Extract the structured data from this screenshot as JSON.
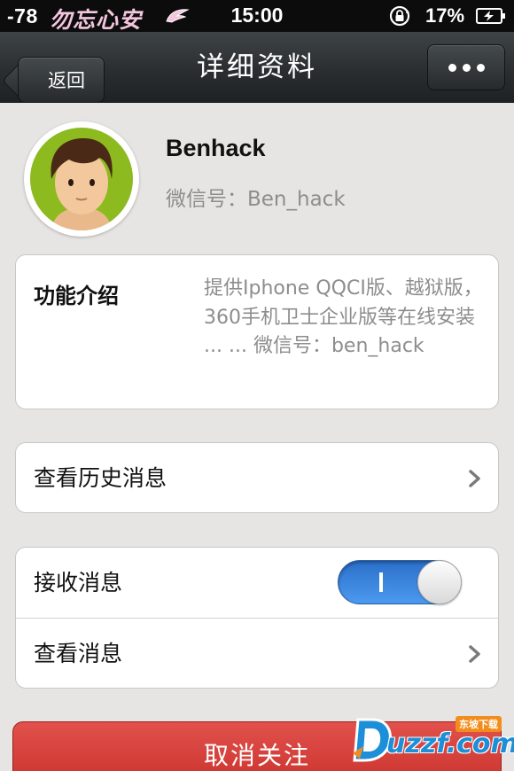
{
  "status_bar": {
    "signal": "-78",
    "carrier": "勿忘心安",
    "time": "15:00",
    "battery_percent": "17%"
  },
  "nav": {
    "back_label": "返回",
    "title": "详细资料",
    "more_icon": "more-dots-icon"
  },
  "profile": {
    "name": "Benhack",
    "wechat_id": "微信号：Ben_hack"
  },
  "intro": {
    "label": "功能介绍",
    "text": "提供Iphone QQCI版、越狱版，360手机卫士企业版等在线安装 ... ... 微信号：ben_hack"
  },
  "history": {
    "label": "查看历史消息"
  },
  "messages": {
    "receive_label": "接收消息",
    "receive_enabled": true,
    "view_label": "查看消息"
  },
  "actions": {
    "unfollow_label": "取消关注"
  },
  "watermark": {
    "text": "uzzf.com",
    "tag": "东坡下载"
  },
  "colors": {
    "toggle_on": "#3d86e0",
    "danger": "#d43d37",
    "navbar": "#2c3032",
    "background": "#e6e5e3"
  }
}
